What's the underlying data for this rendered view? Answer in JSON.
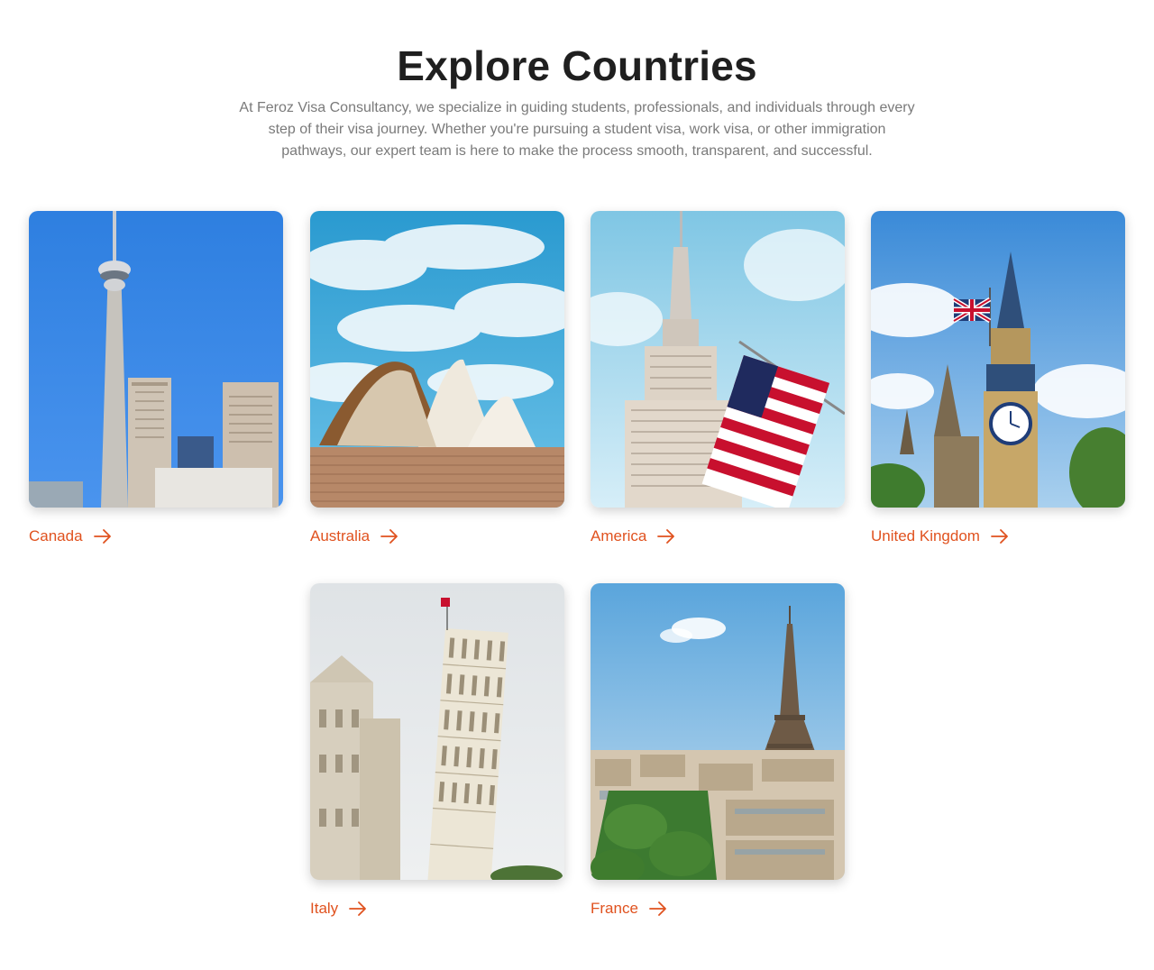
{
  "header": {
    "title": "Explore Countries",
    "description": "At Feroz Visa Consultancy, we specialize in guiding students, professionals, and individuals through every step of their visa journey. Whether you're pursuing a student visa, work visa, or other immigration pathways, our expert team is here to make the process smooth, transparent, and successful."
  },
  "accent_color": "#e0521f",
  "countries": [
    {
      "label": "Canada",
      "image": "cn-tower-toronto-photo",
      "icon": "arrow-right-icon"
    },
    {
      "label": "Australia",
      "image": "sydney-opera-house-photo",
      "icon": "arrow-right-icon"
    },
    {
      "label": "America",
      "image": "empire-state-building-us-flag-photo",
      "icon": "arrow-right-icon"
    },
    {
      "label": "United Kingdom",
      "image": "big-ben-union-jack-photo",
      "icon": "arrow-right-icon"
    },
    {
      "label": "Italy",
      "image": "leaning-tower-of-pisa-photo",
      "icon": "arrow-right-icon"
    },
    {
      "label": "France",
      "image": "eiffel-tower-paris-photo",
      "icon": "arrow-right-icon"
    }
  ]
}
